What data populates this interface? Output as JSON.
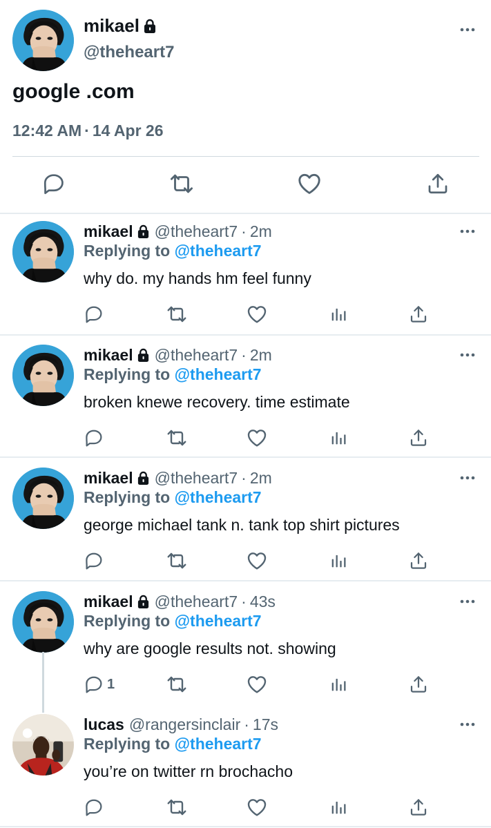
{
  "main_tweet": {
    "name": "mikael",
    "handle": "@theheart7",
    "text": "google .com",
    "time": "12:42 AM",
    "date": "14 Apr 26",
    "dot": "·"
  },
  "replies": [
    {
      "name": "mikael",
      "handle": "@theheart7",
      "dot": "·",
      "time": "2m",
      "replying_prefix": "Replying to",
      "replying_to": "@theheart7",
      "text": "why do.  my hands hm feel funny",
      "reply_count": ""
    },
    {
      "name": "mikael",
      "handle": "@theheart7",
      "dot": "·",
      "time": "2m",
      "replying_prefix": "Replying to",
      "replying_to": "@theheart7",
      "text": "broken knewe recovery. time estimate",
      "reply_count": ""
    },
    {
      "name": "mikael",
      "handle": "@theheart7",
      "dot": "·",
      "time": "2m",
      "replying_prefix": "Replying to",
      "replying_to": "@theheart7",
      "text": "george michael tank n.  tank top shirt pictures",
      "reply_count": ""
    },
    {
      "name": "mikael",
      "handle": "@theheart7",
      "dot": "·",
      "time": "43s",
      "replying_prefix": "Replying to",
      "replying_to": "@theheart7",
      "text": "why are google results not. showing",
      "reply_count": "1"
    },
    {
      "name": "lucas",
      "handle": "@rangersinclair",
      "dot": "·",
      "time": "17s",
      "replying_prefix": "Replying to",
      "replying_to": "@theheart7",
      "text": "you’re on twitter rn brochacho",
      "reply_count": ""
    }
  ],
  "icons": {
    "reply": "comment-icon",
    "retweet": "retweet-icon",
    "like": "heart-icon",
    "views": "analytics-icon",
    "share": "share-icon",
    "more": "more-dots-icon",
    "protected": "lock-icon"
  },
  "colors": {
    "text": "#0f1419",
    "secondary": "#536471",
    "accent": "#1d9bf0",
    "divider": "#e6ecf0"
  }
}
